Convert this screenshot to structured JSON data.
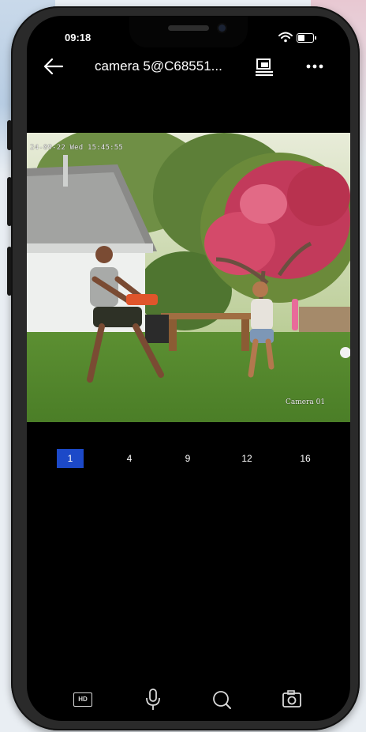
{
  "status_bar": {
    "time": "09:18",
    "icons": [
      "wifi-icon",
      "battery-icon"
    ]
  },
  "nav": {
    "title": "camera 5@C68551...",
    "back_icon": "arrow-left-icon",
    "device_icon": "device-settings-icon",
    "more_icon": "more-dots-icon"
  },
  "video": {
    "timestamp": "24-09-22 Wed 15:45:55",
    "camera_label": "Camera 01"
  },
  "split_options": [
    {
      "label": "1",
      "active": true
    },
    {
      "label": "4",
      "active": false
    },
    {
      "label": "9",
      "active": false
    },
    {
      "label": "12",
      "active": false
    },
    {
      "label": "16",
      "active": false
    }
  ],
  "toolbar": {
    "hd_label": "HD",
    "icons": [
      "hd-icon",
      "microphone-icon",
      "zoom-search-icon",
      "snapshot-camera-icon"
    ]
  },
  "colors": {
    "accent": "#1c49c8",
    "screen_bg": "#000000",
    "text": "#ffffff"
  }
}
